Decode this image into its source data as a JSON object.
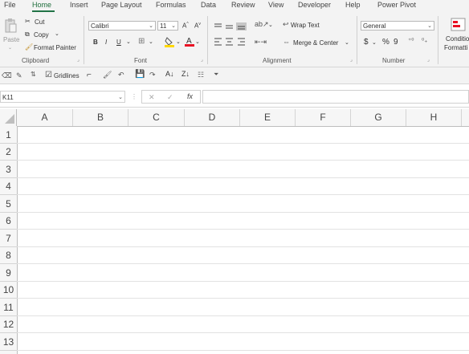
{
  "tabs": [
    "File",
    "Home",
    "Insert",
    "Page Layout",
    "Formulas",
    "Data",
    "Review",
    "View",
    "Developer",
    "Help",
    "Power Pivot"
  ],
  "clipboard": {
    "paste": "Paste",
    "cut": "Cut",
    "copy": "Copy",
    "format_painter": "Format Painter",
    "label": "Clipboard"
  },
  "font": {
    "name": "Calibri",
    "size": "11",
    "grow": "A",
    "shrink": "A",
    "bold": "B",
    "italic": "I",
    "underline": "U",
    "label": "Font"
  },
  "alignment": {
    "wrap_text": "Wrap Text",
    "merge_center": "Merge & Center",
    "label": "Alignment"
  },
  "number": {
    "format": "General",
    "currency": "$",
    "percent": "%",
    "comma": "9",
    "label": "Number"
  },
  "styles": {
    "conditional_1": "Conditio",
    "conditional_2": "Formatti"
  },
  "qat": {
    "gridlines": "Gridlines"
  },
  "formula_bar": {
    "name_box": "K11",
    "cancel": "✕",
    "enter": "✓",
    "fx": "fx",
    "formula": ""
  },
  "columns": [
    "A",
    "B",
    "C",
    "D",
    "E",
    "F",
    "G",
    "H"
  ],
  "rows": [
    "1",
    "2",
    "3",
    "4",
    "5",
    "6",
    "7",
    "8",
    "9",
    "10",
    "11",
    "12",
    "13"
  ],
  "colors": {
    "accent": "#217346",
    "font_color": "#e81123",
    "highlight": "#ffd800"
  }
}
